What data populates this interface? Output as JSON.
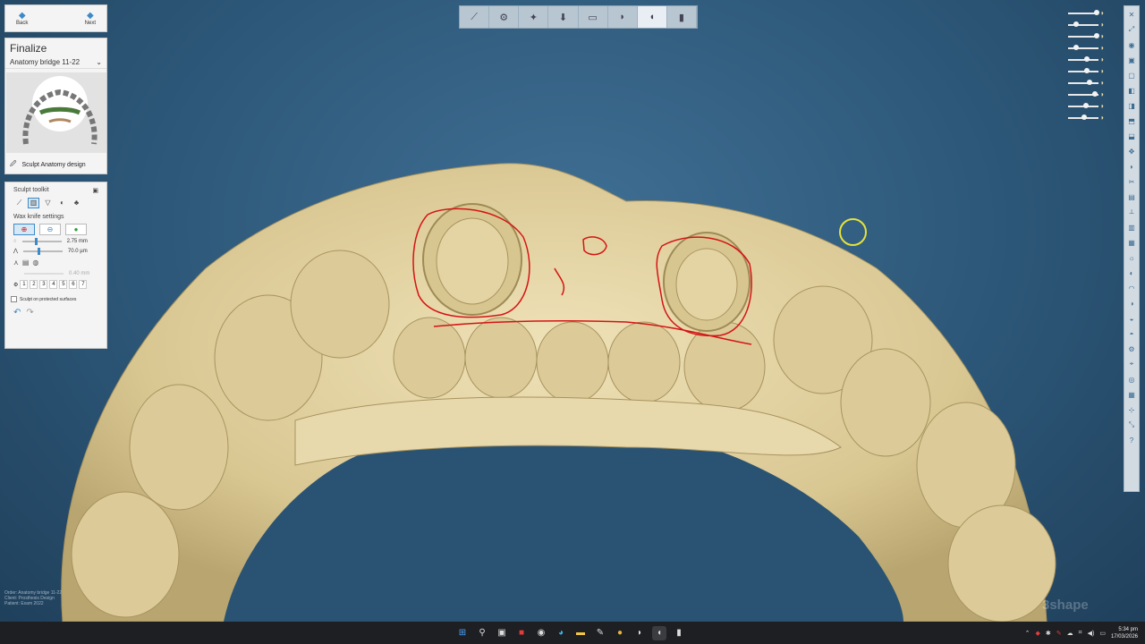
{
  "nav": {
    "back_label": "Back",
    "next_label": "Next"
  },
  "finalize": {
    "title": "Finalize",
    "selection": "Anatomy bridge 11-22",
    "action_label": "Sculpt Anatomy design"
  },
  "sculpt": {
    "title": "Sculpt toolkit",
    "settings_title": "Wax knife settings",
    "size_value": "2.75 mm",
    "depth_value": "70.0 µm",
    "offset_value": "0.40 mm",
    "size_level": 0.35,
    "depth_level": 0.4,
    "numbers": [
      "1",
      "2",
      "3",
      "4",
      "5",
      "6",
      "7"
    ],
    "protected_label": "Sculpt on protected surfaces"
  },
  "toolbar": {
    "icons": [
      "prepare-icon",
      "design-icon",
      "margin-icon",
      "insertion-icon",
      "cement-icon",
      "anatomy-icon",
      "sculpt-icon",
      "connector-icon"
    ],
    "selected_index": 6
  },
  "right_toolbar": {
    "icons": [
      "close-icon",
      "fullscreen-icon",
      "sphere-icon",
      "view-front-icon",
      "view-back-icon",
      "view-left-icon",
      "view-right-icon",
      "view-top-icon",
      "view-bottom-icon",
      "pan-icon",
      "tooth-icon",
      "cut-icon",
      "section-icon",
      "measure-icon",
      "scan-icon",
      "screenshot-icon",
      "light-icon",
      "profile-icon",
      "arch-icon",
      "opacity-icon",
      "color-icon",
      "slice-icon",
      "settings-icon",
      "pin-icon",
      "camera-icon",
      "grid-icon",
      "snap-icon",
      "fit-icon",
      "help-icon"
    ]
  },
  "visibility": {
    "levels": [
      0.95,
      0.2,
      0.95,
      0.2,
      0.6,
      0.6,
      0.7,
      0.9,
      0.55,
      0.5
    ]
  },
  "info": {
    "line1": "Order:    Anatomy bridge 11-22",
    "line2": "Client:   Prosthesis Design",
    "line3": "Patient:  Exam 2022"
  },
  "brand": "3shape",
  "taskbar": {
    "time": "5:34 pm",
    "date": "17/03/2026"
  },
  "colors": {
    "model": "#e3d3a3",
    "margin_line": "#d41414",
    "accent": "#3d8ac7"
  }
}
